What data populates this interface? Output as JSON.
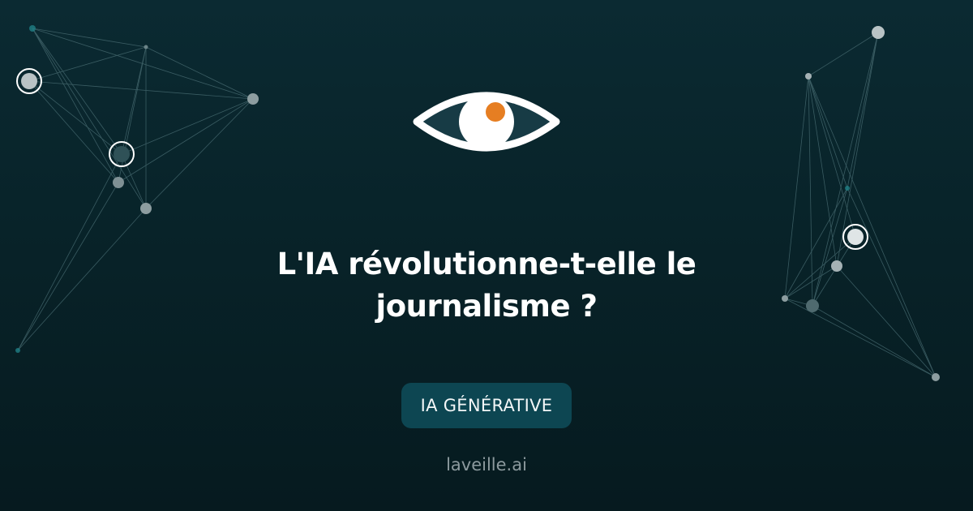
{
  "logo": {
    "icon": "eye-icon",
    "iris_color": "#ffffff",
    "pupil_color": "#e67e22",
    "outline_color": "#ffffff",
    "fill_color": "#173b45"
  },
  "headline": {
    "line1": "L'IA révolutionne-t-elle le",
    "line2": "journalisme ?"
  },
  "tag": {
    "label": "IA GÉNÉRATIVE"
  },
  "footer": {
    "site": "laveille.ai"
  },
  "colors": {
    "background": "#082329",
    "tag_background": "#0d4652",
    "network_lines": "#4a6e74",
    "network_nodes": "#9aa9ad"
  }
}
